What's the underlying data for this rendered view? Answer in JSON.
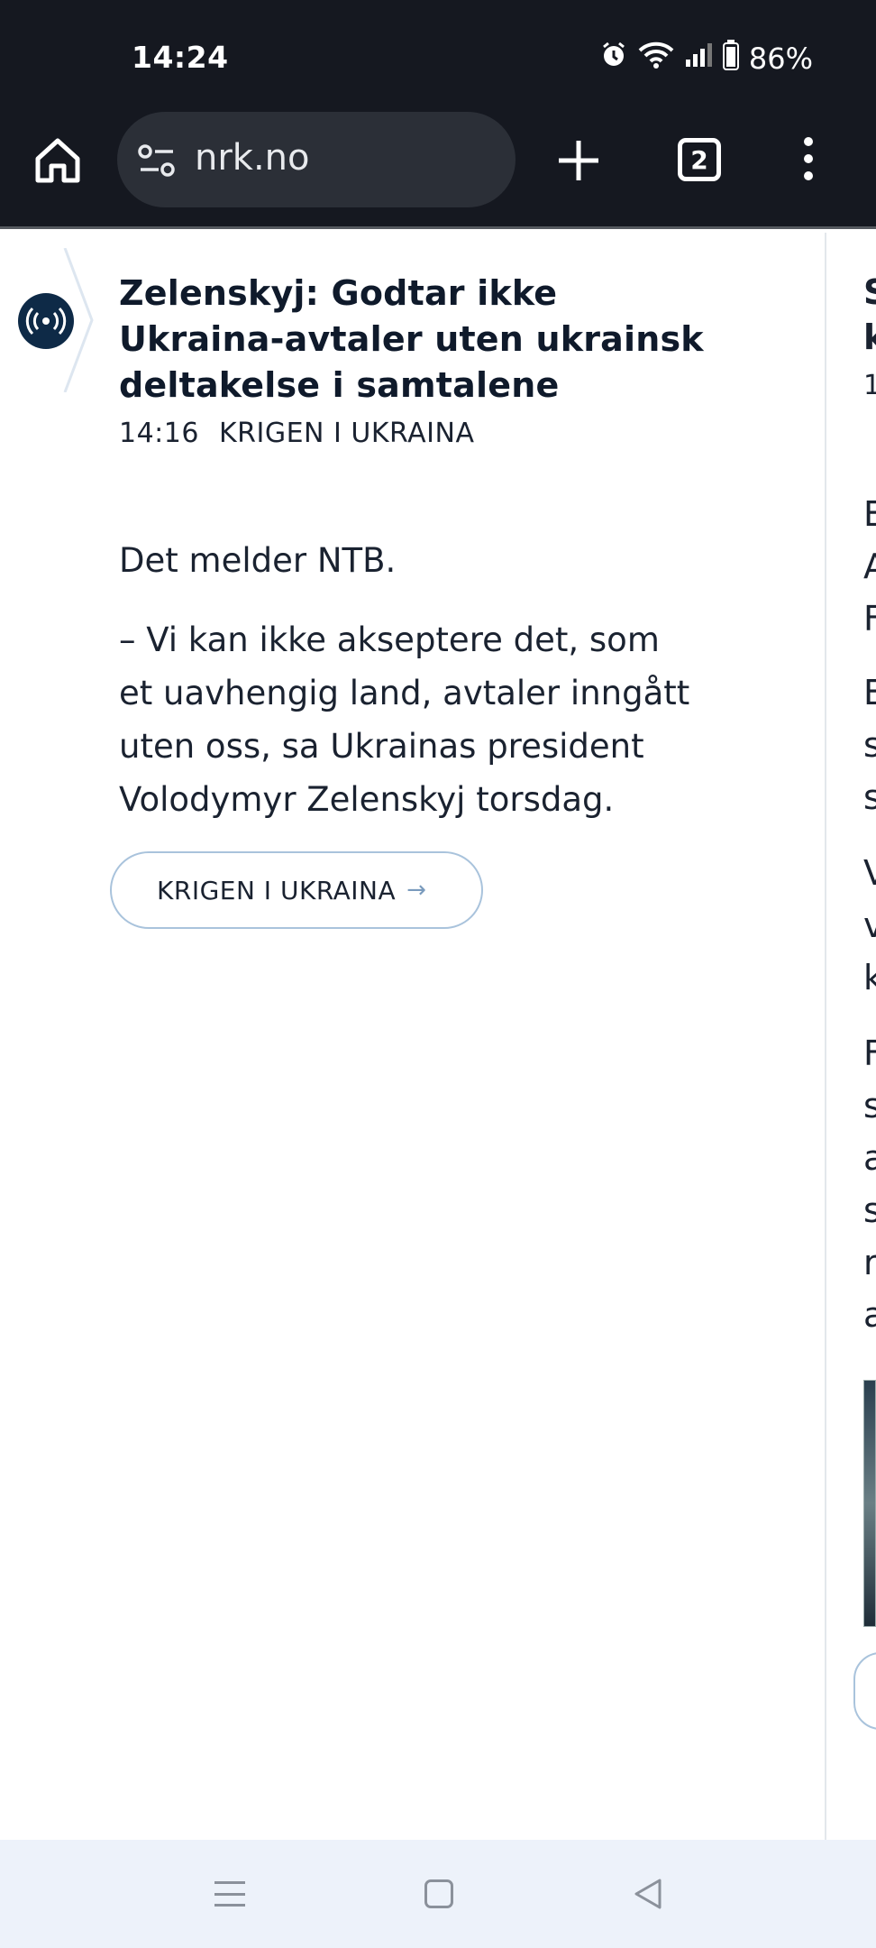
{
  "status_bar": {
    "time": "14:24",
    "battery": "86%",
    "icons": [
      "alarm-icon",
      "wifi-icon",
      "signal-icon",
      "battery-icon"
    ]
  },
  "browser": {
    "url": "nrk.no",
    "tab_count": "2",
    "icons": [
      "home-icon",
      "site-settings-icon",
      "new-tab-icon",
      "tabs-icon",
      "more-menu-icon"
    ]
  },
  "article": {
    "headline": "Zelenskyj: Godtar ikke Ukraina-avtaler uten ukrainsk deltakelse i samtalene",
    "time": "14:16",
    "category": "KRIGEN I UKRAINA",
    "paragraph1": "Det melder NTB.",
    "paragraph2": "– Vi kan ikke akseptere det, som et uavhengig land, avtaler inngått uten oss, sa Ukrainas president Volodymyr Zelenskyj torsdag.",
    "topic_button": "KRIGEN I UKRAINA",
    "topic_arrow": "→"
  },
  "next_column_peek": {
    "line1": "S",
    "line2": "k",
    "line3": "1",
    "body_letters": [
      "E",
      "A",
      "F",
      "E",
      "s",
      "s",
      "V",
      "v",
      "k",
      "F",
      "s",
      "a",
      "s",
      "r",
      "a"
    ]
  },
  "colors": {
    "bar_bg": "#151820",
    "url_bg": "#2b2f37",
    "live_badge": "#0e2a47",
    "pill_border": "#a9c3dc",
    "nav_bg": "#edf2fa"
  }
}
